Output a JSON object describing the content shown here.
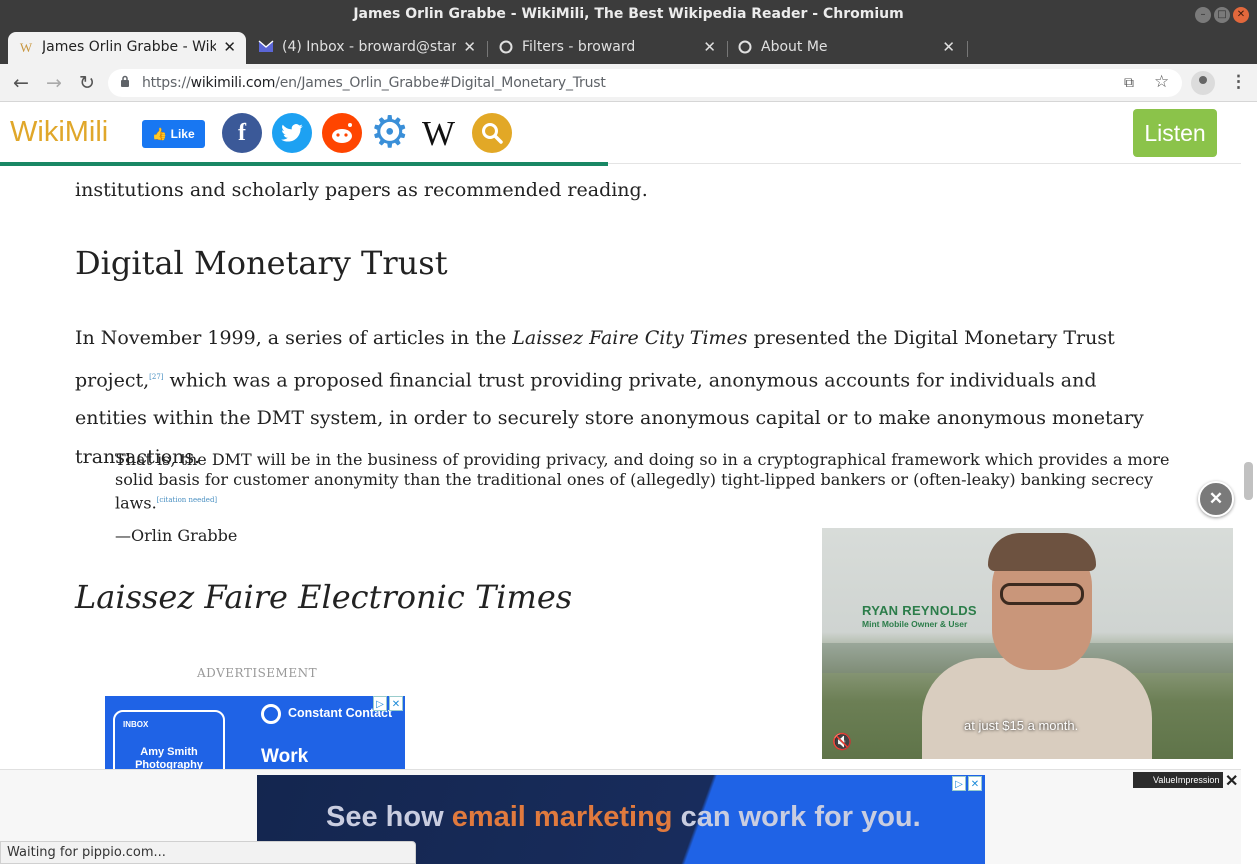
{
  "window": {
    "title": "James Orlin Grabbe - WikiMili, The Best Wikipedia Reader - Chromium"
  },
  "tabs": [
    {
      "label": "James Orlin Grabbe - WikiMili",
      "favicon": "W"
    },
    {
      "label": "(4) Inbox - broward@startmail",
      "favicon": "mail"
    },
    {
      "label": "Filters - broward",
      "favicon": "O"
    },
    {
      "label": "About Me",
      "favicon": "O"
    }
  ],
  "toolbar": {
    "url_prefix": "https://",
    "url_host": "wikimili.com",
    "url_path": "/en/James_Orlin_Grabbe#Digital_Monetary_Trust"
  },
  "site": {
    "logo": "WikiMili",
    "like_label": "Like",
    "listen_label": "Listen"
  },
  "article": {
    "prev_text": "institutions and scholarly papers as recommended reading.",
    "section_heading": "Digital Monetary Trust",
    "para_part1": "In November 1999, a series of articles in the ",
    "para_italic": "Laissez Faire City Times",
    "para_part2": " presented the Digital Monetary Trust project,",
    "para_ref": "[27]",
    "para_part3": " which was a proposed financial trust providing private, anonymous accounts for individuals and entities within the DMT system, in order to securely store anonymous capital or to make anonymous monetary transactions.",
    "quote": "That is, the DMT will be in the business of providing privacy, and doing so in a cryptographical framework which provides a more solid basis for customer anonymity than the traditional ones of (allegedly) tight-lipped bankers or (often-leaky) banking secrecy laws.",
    "quote_ref": "[citation needed]",
    "attribution": "—Orlin Grabbe",
    "subheading": "Laissez Faire Electronic Times",
    "ad_label": "ADVERTISEMENT"
  },
  "sidebar_ad": {
    "inbox_label": "INBOX",
    "card_name": "Amy Smith Photography",
    "brand": "Constant Contact",
    "headline": "Work"
  },
  "video_ad": {
    "name": "RYAN REYNOLDS",
    "role": "Mint Mobile Owner & User",
    "caption": "at just $15 a month."
  },
  "bottom_ad": {
    "brand_tag": "ValueImpression",
    "text_part1": "See how ",
    "text_highlight": "email marketing",
    "text_part2": " can work for you."
  },
  "status_bar": {
    "text": "Waiting for pippio.com..."
  },
  "colors": {
    "logo": "#e0a72a",
    "listen_button": "#8bc34a",
    "reading_progress": "#198764",
    "ad_blue": "#1f63e6"
  },
  "reading_progress": 0.49
}
